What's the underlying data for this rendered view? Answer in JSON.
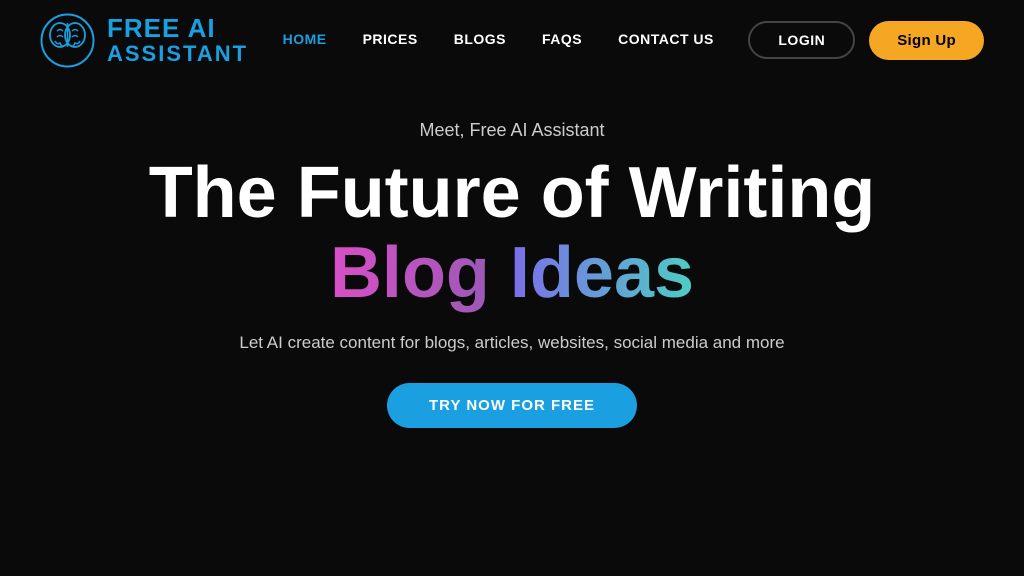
{
  "nav": {
    "logo": {
      "line1": "FREE AI",
      "line2": "ASSISTANT"
    },
    "links": [
      {
        "label": "HOME",
        "active": true
      },
      {
        "label": "PRICES",
        "active": false
      },
      {
        "label": "BLOGS",
        "active": false
      },
      {
        "label": "FAQS",
        "active": false
      },
      {
        "label": "CONTACT US",
        "active": false
      }
    ],
    "login_label": "LOGIN",
    "signup_label": "Sign Up"
  },
  "hero": {
    "subtitle": "Meet, Free AI Assistant",
    "title_line1": "The Future of Writing",
    "title_word1": "Blog",
    "title_word2": "Ideas",
    "description": "Let AI create content for blogs, articles, websites, social media and more",
    "cta_label": "TRY NOW FOR FREE"
  }
}
